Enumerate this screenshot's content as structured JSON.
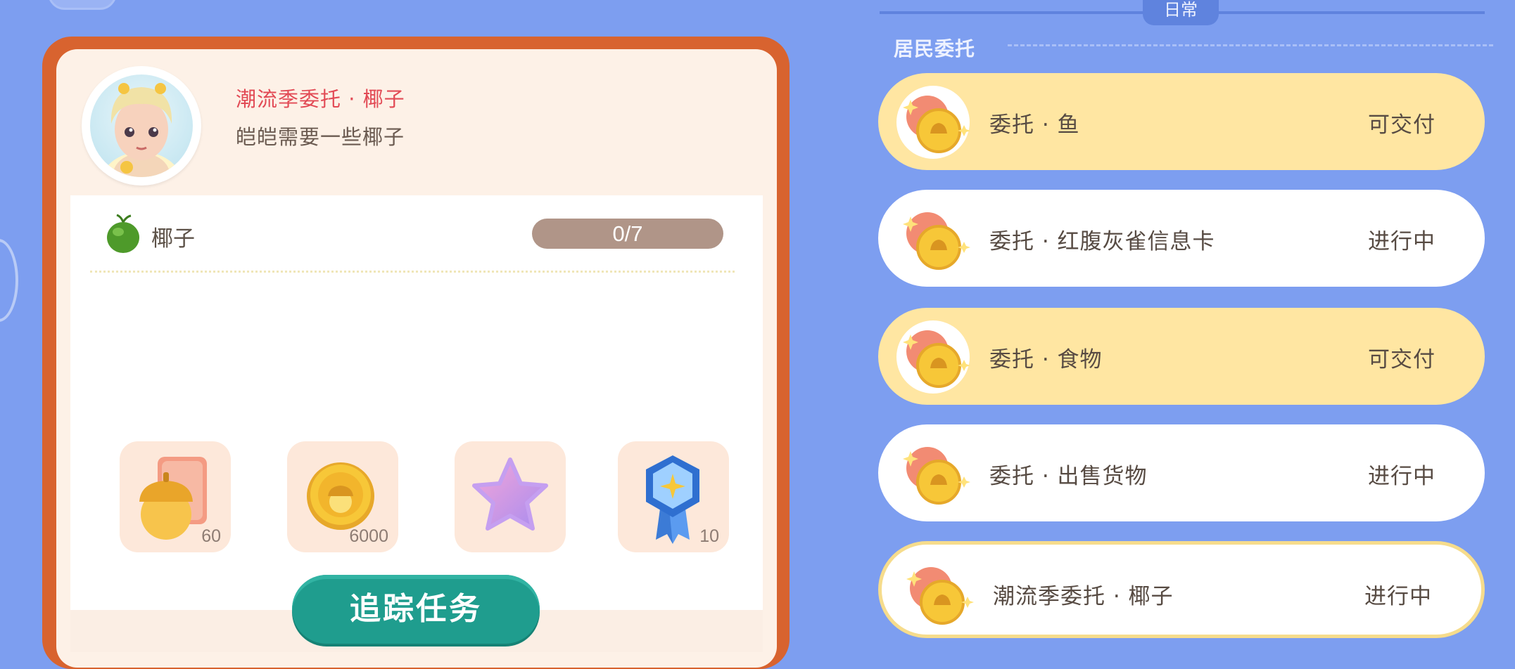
{
  "detail": {
    "title": "潮流季委托 · 椰子",
    "description": "皑皑需要一些椰子",
    "requirement": {
      "item": "椰子",
      "progress": "0/7"
    },
    "rewards": [
      {
        "icon": "acorn-card-icon",
        "count": "60"
      },
      {
        "icon": "acorn-coin-icon",
        "count": "6000"
      },
      {
        "icon": "star-icon",
        "count": ""
      },
      {
        "icon": "medal-icon",
        "count": "10"
      }
    ],
    "track_button": "追踪任务"
  },
  "list": {
    "section_tab": "日常",
    "subsection": "居民委托",
    "items": [
      {
        "name": "委托 · 鱼",
        "status": "可交付",
        "state": "ready"
      },
      {
        "name": "委托 · 红腹灰雀信息卡",
        "status": "进行中",
        "state": "progress"
      },
      {
        "name": "委托 · 食物",
        "status": "可交付",
        "state": "ready"
      },
      {
        "name": "委托 · 出售货物",
        "status": "进行中",
        "state": "progress"
      },
      {
        "name": "潮流季委托 · 椰子",
        "status": "进行中",
        "state": "selected"
      }
    ]
  },
  "colors": {
    "background": "#7d9ef0",
    "card_border": "#d8632f",
    "title_red": "#e24a55",
    "ready_yellow": "#ffe6a2",
    "button_teal": "#1f9d8e"
  }
}
